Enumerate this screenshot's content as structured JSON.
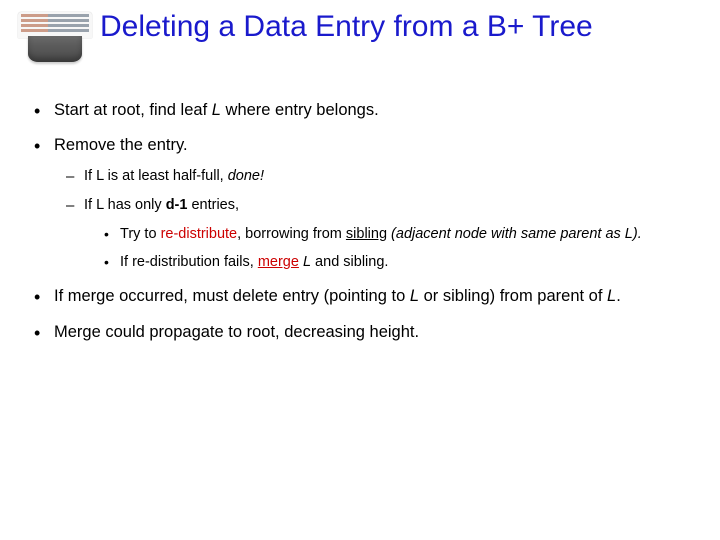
{
  "title": "Deleting a Data Entry from a B+ Tree",
  "b1": {
    "pre": "Start at root, find leaf ",
    "L": "L",
    "post": " where entry belongs."
  },
  "b2": "Remove the entry.",
  "b2a": {
    "pre": "If L is at least half-full, ",
    "done": "done!"
  },
  "b2b": {
    "pre": "If L has only ",
    "d1": "d-1",
    "post": " entries,"
  },
  "b2b1": {
    "pre": "Try to ",
    "redist": "re-distribute",
    "mid": ", borrowing from ",
    "sibling": "sibling",
    "paren": " (adjacent node with same parent as L)."
  },
  "b2b2": {
    "pre": "If re-distribution fails, ",
    "merge": "merge",
    "sp": " ",
    "L": "L",
    "post": " and sibling."
  },
  "b3": {
    "pre": "If merge occurred, must delete entry (pointing to ",
    "L": "L",
    "post": " or sibling) from parent of ",
    "L2": "L",
    "end": "."
  },
  "b4": "Merge could propagate to root, decreasing height."
}
